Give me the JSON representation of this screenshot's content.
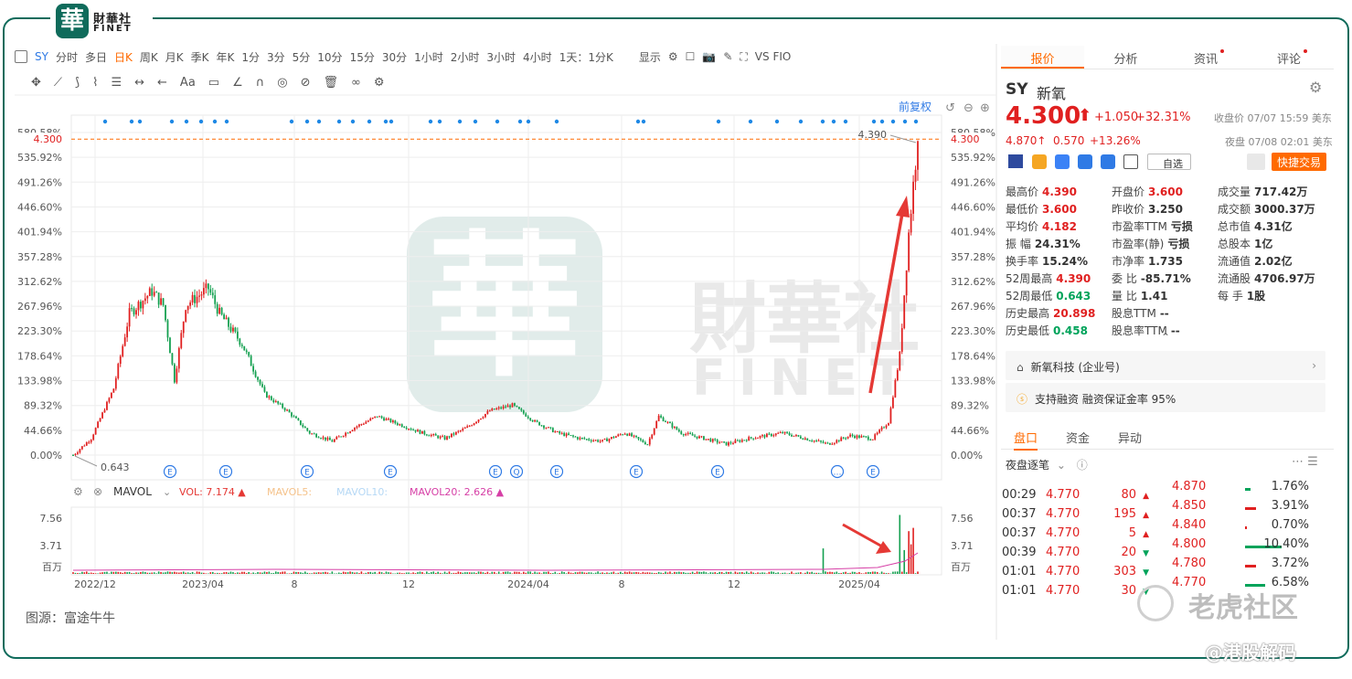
{
  "brand": {
    "seal": "華",
    "name": "財華社",
    "sub": "FINET"
  },
  "toolbar": {
    "symbol": "SY",
    "timeframes": [
      "分时",
      "多日",
      "日K",
      "周K",
      "月K",
      "季K",
      "年K",
      "1分",
      "3分",
      "5分",
      "10分",
      "15分",
      "30分",
      "1小时",
      "2小时",
      "3小时",
      "4小时"
    ],
    "active_timeframe": "日K",
    "day_setting": "1天：1分K",
    "display": "显示",
    "vs_label": "VS FIO"
  },
  "drawtools": [
    "Aa"
  ],
  "right_tabs": [
    {
      "label": "报价",
      "active": true
    },
    {
      "label": "分析"
    },
    {
      "label": "资讯",
      "dot": true
    },
    {
      "label": "评论",
      "dot": true
    }
  ],
  "chart": {
    "fuquan": "前复权",
    "y_labels": [
      "580.58%",
      "535.92%",
      "491.26%",
      "446.60%",
      "401.94%",
      "357.28%",
      "312.62%",
      "267.96%",
      "223.30%",
      "178.64%",
      "133.98%",
      "89.32%",
      "44.66%",
      "0.00%"
    ],
    "current_price_label": "4.300",
    "high_label": "4.390",
    "low_label": "0.643",
    "x_labels": [
      "2022/12",
      "2023/04",
      "8",
      "12",
      "2024/04",
      "8",
      "12",
      "2025/04"
    ],
    "indicator": {
      "name": "MAVOL",
      "vol": "VOL:  7.174",
      "mavol5": "MAVOL5:",
      "mavol10": "MAVOL10:",
      "mavol20": "MAVOL20:  2.626"
    },
    "vol_y_labels": [
      "7.56",
      "3.71",
      "百万"
    ],
    "colors": {
      "up": "#e02020",
      "down": "#14a050",
      "accent": "#ff6a00",
      "link": "#2f7ae5",
      "grid": "#eeeeee"
    }
  },
  "chart_data": {
    "type": "candlestick",
    "title": "SY 新氧 日K",
    "y_unit": "%",
    "ylim": [
      -3,
      582
    ],
    "start_price": 0.643,
    "current": 4.3,
    "high": 4.39,
    "anchors": [
      [
        0,
        0
      ],
      [
        8,
        30
      ],
      [
        18,
        120
      ],
      [
        25,
        255
      ],
      [
        35,
        295
      ],
      [
        40,
        270
      ],
      [
        45,
        135
      ],
      [
        50,
        270
      ],
      [
        60,
        300
      ],
      [
        65,
        255
      ],
      [
        75,
        200
      ],
      [
        85,
        110
      ],
      [
        95,
        80
      ],
      [
        105,
        40
      ],
      [
        115,
        25
      ],
      [
        125,
        50
      ],
      [
        135,
        70
      ],
      [
        145,
        55
      ],
      [
        155,
        40
      ],
      [
        165,
        30
      ],
      [
        175,
        50
      ],
      [
        185,
        80
      ],
      [
        195,
        90
      ],
      [
        205,
        60
      ],
      [
        215,
        40
      ],
      [
        225,
        30
      ],
      [
        235,
        25
      ],
      [
        245,
        40
      ],
      [
        255,
        20
      ],
      [
        260,
        70
      ],
      [
        270,
        40
      ],
      [
        280,
        30
      ],
      [
        290,
        20
      ],
      [
        300,
        30
      ],
      [
        315,
        40
      ],
      [
        325,
        30
      ],
      [
        335,
        20
      ],
      [
        345,
        35
      ],
      [
        355,
        30
      ],
      [
        362,
        60
      ],
      [
        367,
        180
      ],
      [
        371,
        400
      ],
      [
        374,
        530
      ],
      [
        375,
        565
      ]
    ],
    "volume_ylim": [
      0,
      8
    ],
    "volume_spikes": [
      [
        333,
        3.1
      ],
      [
        367,
        7.17
      ],
      [
        369,
        2.9
      ],
      [
        371,
        5.2
      ],
      [
        372,
        3.6
      ],
      [
        373,
        5.6
      ]
    ]
  },
  "quote": {
    "symbol": "SY",
    "name": "新氧",
    "price": "4.300",
    "price_arrow": "⬆",
    "change": "+1.050",
    "change_pct": "+32.31%",
    "close_time": "收盘价 07/07 15:59 美东",
    "night_price": "4.870↑",
    "night_change": "0.570",
    "night_pct": "+13.26%",
    "night_time": "夜盘 07/08 02:01 美东",
    "watch_label": "自选",
    "trade_button": "快捷交易",
    "stats": [
      {
        "k": "最高价",
        "v": "4.390",
        "c": "up"
      },
      {
        "k": "开盘价",
        "v": "3.600",
        "c": "up"
      },
      {
        "k": "成交量",
        "v": "717.42万",
        "c": ""
      },
      {
        "k": "最低价",
        "v": "3.600",
        "c": "up"
      },
      {
        "k": "昨收价",
        "v": "3.250",
        "c": ""
      },
      {
        "k": "成交额",
        "v": "3000.37万",
        "c": ""
      },
      {
        "k": "平均价",
        "v": "4.182",
        "c": "up"
      },
      {
        "k": "市盈率TTM",
        "v": "亏损",
        "c": ""
      },
      {
        "k": "总市值",
        "v": "4.31亿",
        "c": ""
      },
      {
        "k": "振    幅",
        "v": "24.31%",
        "c": ""
      },
      {
        "k": "市盈率(静)",
        "v": "亏损",
        "c": ""
      },
      {
        "k": "总股本",
        "v": "1亿",
        "c": ""
      },
      {
        "k": "换手率",
        "v": "15.24%",
        "c": ""
      },
      {
        "k": "市净率",
        "v": "1.735",
        "c": ""
      },
      {
        "k": "流通值",
        "v": "2.02亿",
        "c": ""
      },
      {
        "k": "52周最高",
        "v": "4.390",
        "c": "up"
      },
      {
        "k": "委    比",
        "v": "-85.71%",
        "c": ""
      },
      {
        "k": "流通股",
        "v": "4706.97万",
        "c": ""
      },
      {
        "k": "52周最低",
        "v": "0.643",
        "c": "dn"
      },
      {
        "k": "量    比",
        "v": "1.41",
        "c": ""
      },
      {
        "k": "每    手",
        "v": "1股",
        "c": ""
      },
      {
        "k": "历史最高",
        "v": "20.898",
        "c": "up"
      },
      {
        "k": "股息TTM",
        "v": "--",
        "c": ""
      },
      {
        "k": "",
        "v": "",
        "c": ""
      },
      {
        "k": "历史最低",
        "v": "0.458",
        "c": "dn"
      },
      {
        "k": "股息率TTM",
        "v": "--",
        "c": ""
      },
      {
        "k": "",
        "v": "",
        "c": ""
      }
    ],
    "company": "新氧科技 (企业号)",
    "margin": "支持融资 融资保证金率 95%"
  },
  "sub_tabs": [
    "盘口",
    "资金",
    "异动"
  ],
  "trades_header": "夜盘逐笔",
  "trades": [
    {
      "t": "00:29",
      "p": "4.770",
      "v": "80",
      "d": "up"
    },
    {
      "t": "00:37",
      "p": "4.770",
      "v": "195",
      "d": "up"
    },
    {
      "t": "00:37",
      "p": "4.770",
      "v": "5",
      "d": "up"
    },
    {
      "t": "00:39",
      "p": "4.770",
      "v": "20",
      "d": "dn"
    },
    {
      "t": "01:01",
      "p": "4.770",
      "v": "303",
      "d": "dn"
    },
    {
      "t": "01:01",
      "p": "4.770",
      "v": "30",
      "d": "dn"
    }
  ],
  "book": [
    {
      "p": "4.870",
      "pct": "1.76%",
      "w": 6,
      "c": "dn"
    },
    {
      "p": "4.850",
      "pct": "3.91%",
      "w": 12,
      "c": "up"
    },
    {
      "p": "4.840",
      "pct": "0.70%",
      "w": 2,
      "c": "up"
    },
    {
      "p": "4.800",
      "pct": "10.40%",
      "w": 40,
      "c": "dn"
    },
    {
      "p": "4.780",
      "pct": "3.72%",
      "w": 12,
      "c": "up"
    },
    {
      "p": "4.770",
      "pct": "6.58%",
      "w": 22,
      "c": "dn"
    }
  ],
  "watermark": "老虎社区",
  "caption": "@港股解码",
  "source": "图源：富途牛牛"
}
